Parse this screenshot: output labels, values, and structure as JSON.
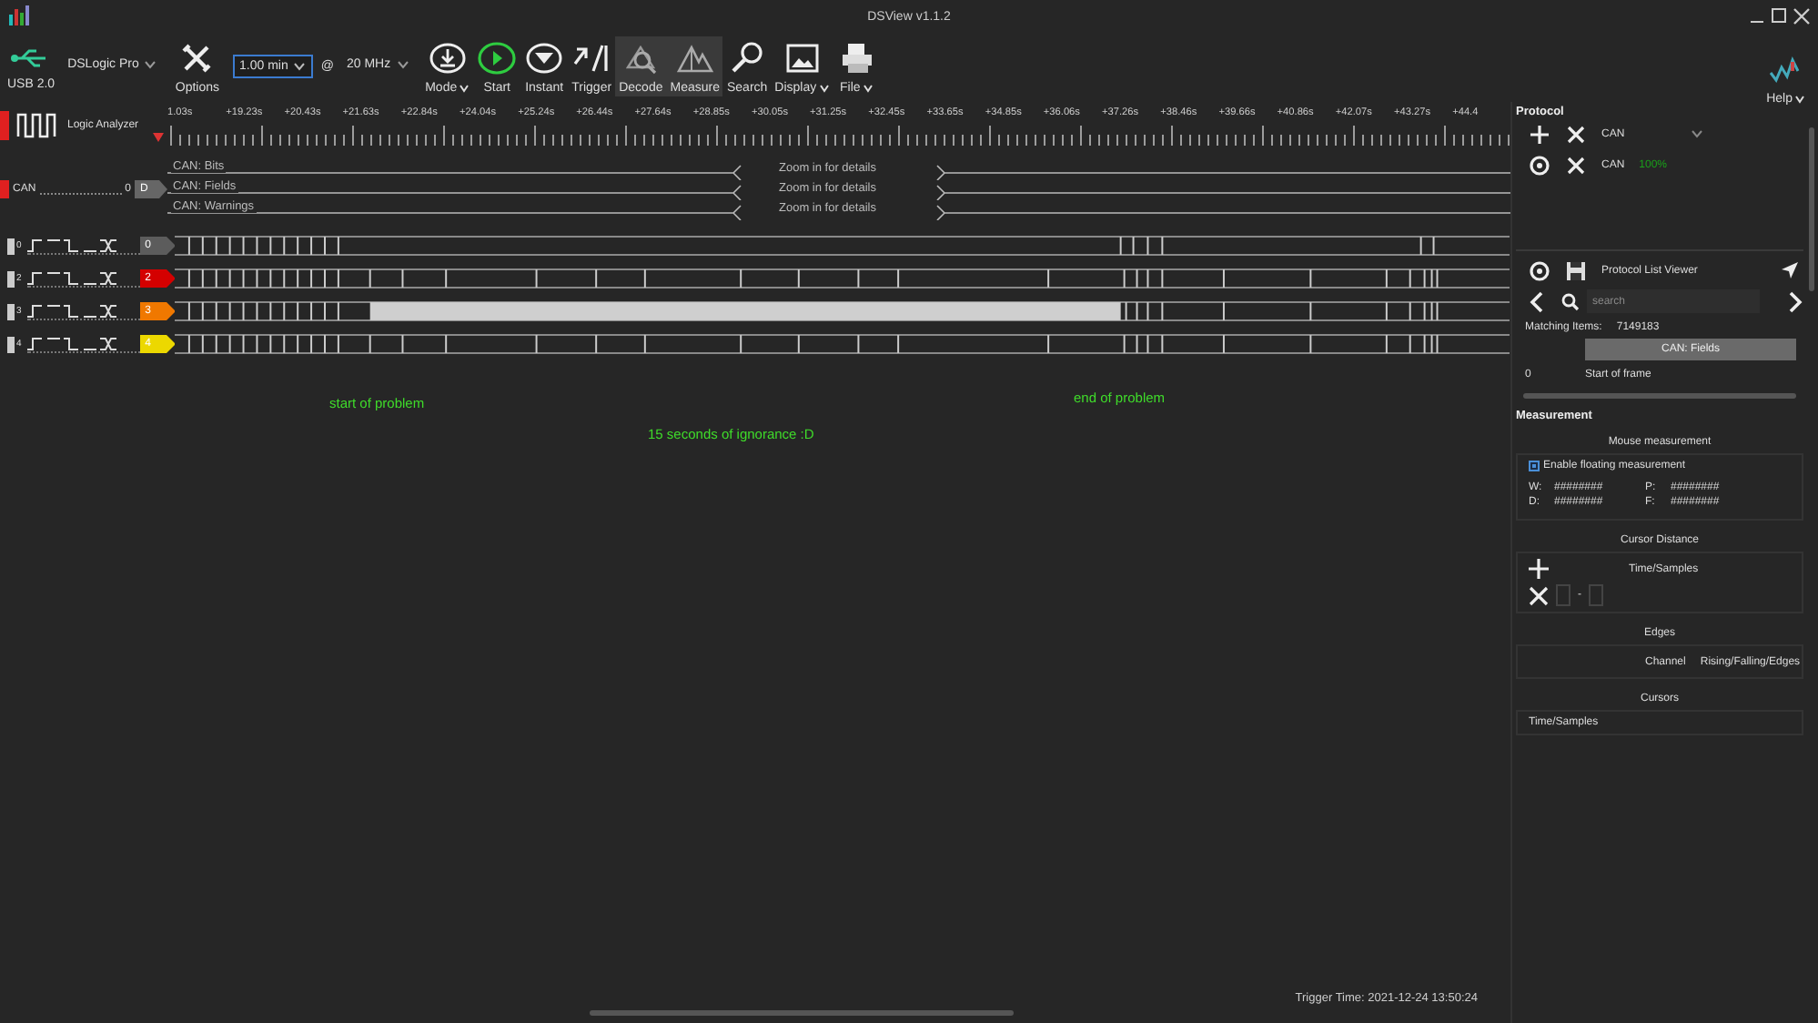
{
  "window": {
    "title": "DSView v1.1.2"
  },
  "toolbar": {
    "interface": "USB 2.0",
    "device": "DSLogic Pro",
    "options": "Options",
    "duration": "1.00 min",
    "at": "@",
    "rate": "20 MHz",
    "buttons": [
      {
        "label": "Mode",
        "menu": true,
        "selected": false
      },
      {
        "label": "Start",
        "menu": false,
        "selected": false
      },
      {
        "label": "Instant",
        "menu": false,
        "selected": false
      },
      {
        "label": "Trigger",
        "menu": false,
        "selected": false
      },
      {
        "label": "Decode",
        "menu": false,
        "selected": true
      },
      {
        "label": "Measure",
        "menu": false,
        "selected": true
      },
      {
        "label": "Search",
        "menu": false,
        "selected": false
      },
      {
        "label": "Display",
        "menu": true,
        "selected": false
      },
      {
        "label": "File",
        "menu": true,
        "selected": false
      }
    ],
    "help": "Help"
  },
  "ruler": {
    "title": "Logic Analyzer",
    "ticks": [
      "1.03s",
      "+19.23s",
      "+20.43s",
      "+21.63s",
      "+22.84s",
      "+24.04s",
      "+25.24s",
      "+26.44s",
      "+27.64s",
      "+28.85s",
      "+30.05s",
      "+31.25s",
      "+32.45s",
      "+33.65s",
      "+34.85s",
      "+36.06s",
      "+37.26s",
      "+38.46s",
      "+39.66s",
      "+40.86s",
      "+42.07s",
      "+43.27s",
      "+44.4"
    ]
  },
  "decoder": {
    "name": "CAN",
    "index": "0",
    "tag": "D",
    "rows": [
      {
        "label": "CAN: Bits",
        "note": "Zoom in for details"
      },
      {
        "label": "CAN: Fields",
        "note": "Zoom in for details"
      },
      {
        "label": "CAN: Warnings",
        "note": "Zoom in for details"
      }
    ]
  },
  "channels": [
    {
      "index": "0",
      "tag": "0",
      "color": "#5c5c5c"
    },
    {
      "index": "2",
      "tag": "2",
      "color": "#d40000"
    },
    {
      "index": "3",
      "tag": "3",
      "color": "#f07800"
    },
    {
      "index": "4",
      "tag": "4",
      "color": "#ecd800"
    }
  ],
  "annotations": [
    "start of problem",
    "end of problem",
    "15 seconds of ignorance :D"
  ],
  "status": {
    "trigger_time": "Trigger Time: 2021-12-24 13:50:24"
  },
  "protocol": {
    "title": "Protocol",
    "add_select": "CAN",
    "decoders": [
      {
        "name": "CAN",
        "progress": "100%",
        "complete": true
      }
    ],
    "list_viewer": {
      "title": "Protocol List Viewer",
      "search_placeholder": "search",
      "matching_label": "Matching Items:",
      "matching_count": "7149183",
      "column": "CAN: Fields",
      "rows": [
        {
          "index": "0",
          "text": "Start of frame"
        }
      ]
    }
  },
  "measurement": {
    "title": "Measurement",
    "mouse": {
      "title": "Mouse measurement",
      "floating": {
        "label": "Enable floating measurement",
        "checked": true
      },
      "readings": [
        {
          "label": "W:",
          "value": "########"
        },
        {
          "label": "P:",
          "value": "########"
        },
        {
          "label": "D:",
          "value": "########"
        },
        {
          "label": "F:",
          "value": "########"
        }
      ]
    },
    "cursor_distance": {
      "title": "Cursor Distance",
      "column": "Time/Samples",
      "separator": "-"
    },
    "edges": {
      "title": "Edges",
      "columns": [
        "Channel",
        "Rising/Falling/Edges"
      ]
    },
    "cursors": {
      "title": "Cursors",
      "column": "Time/Samples"
    }
  }
}
